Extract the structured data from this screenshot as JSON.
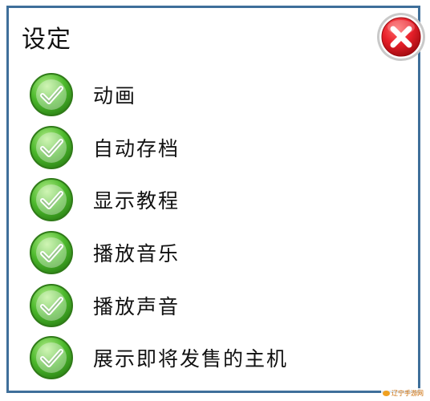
{
  "dialog": {
    "title": "设定",
    "close_icon": "close-x-icon",
    "close_color": "#e8202a"
  },
  "options": [
    {
      "label": "动画",
      "checked": true
    },
    {
      "label": "自动存档",
      "checked": true
    },
    {
      "label": "显示教程",
      "checked": true
    },
    {
      "label": "播放音乐",
      "checked": true
    },
    {
      "label": "播放声音",
      "checked": true
    },
    {
      "label": "展示即将发售的主机",
      "checked": true
    }
  ],
  "colors": {
    "frame": "#3f6f9a",
    "check_green": "#4cb82c",
    "check_outline": "#2f8a18"
  },
  "watermark": {
    "text": "辽宁手游网"
  }
}
